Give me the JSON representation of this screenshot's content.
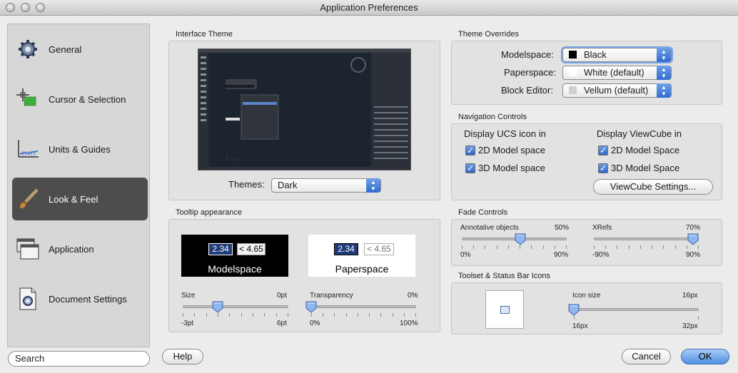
{
  "window": {
    "title": "Application Preferences"
  },
  "sidebar": {
    "items": [
      {
        "label": "General",
        "icon": "gear-icon"
      },
      {
        "label": "Cursor & Selection",
        "icon": "crosshair-icon"
      },
      {
        "label": "Units & Guides",
        "icon": "ruler-icon"
      },
      {
        "label": "Look & Feel",
        "icon": "brush-icon",
        "active": true
      },
      {
        "label": "Application",
        "icon": "windows-icon"
      },
      {
        "label": "Document Settings",
        "icon": "document-icon"
      }
    ],
    "search_value": "Search"
  },
  "interface_theme": {
    "title": "Interface Theme",
    "themes_label": "Themes:",
    "themes_value": "Dark"
  },
  "tooltip": {
    "title": "Tooltip appearance",
    "model_value1": "2.34",
    "model_value2": "< 4.65",
    "model_label": "Modelspace",
    "paper_value1": "2.34",
    "paper_value2": "< 4.65",
    "paper_label": "Paperspace",
    "size": {
      "label": "Size",
      "current": "0pt",
      "min": "-3pt",
      "max": "6pt",
      "value_fraction": 0.33
    },
    "transparency": {
      "label": "Transparency",
      "current": "0%",
      "min": "0%",
      "max": "100%",
      "value_fraction": 0.0
    }
  },
  "theme_overrides": {
    "title": "Theme Overrides",
    "rows": [
      {
        "label": "Modelspace:",
        "value": "Black",
        "swatch": "#000000"
      },
      {
        "label": "Paperspace:",
        "value": "White (default)",
        "swatch": "#ffffff"
      },
      {
        "label": "Block Editor:",
        "value": "Vellum (default)",
        "swatch": "#d8d8d8"
      }
    ]
  },
  "navigation": {
    "title": "Navigation Controls",
    "ucs_heading": "Display UCS icon in",
    "ucs_2d": "2D Model space",
    "ucs_3d": "3D Model space",
    "vc_heading": "Display ViewCube in",
    "vc_2d": "2D Model Space",
    "vc_3d": "3D Model Space",
    "settings_button": "ViewCube Settings..."
  },
  "fade": {
    "title": "Fade Controls",
    "annotative": {
      "label": "Annotative objects",
      "current": "50%",
      "min": "0%",
      "max": "90%",
      "value_fraction": 0.556
    },
    "xrefs": {
      "label": "XRefs",
      "current": "70%",
      "min": "-90%",
      "max": "90%",
      "value_fraction": 0.944
    }
  },
  "toolset": {
    "title": "Toolset & Status Bar Icons",
    "icon_size_label": "Icon size",
    "current": "16px",
    "min": "16px",
    "max": "32px",
    "value_fraction": 0.0
  },
  "footer": {
    "help": "Help",
    "cancel": "Cancel",
    "ok": "OK"
  },
  "colors": {
    "accent": "#3f7fde",
    "active_sidebar": "#4d4d4d",
    "preview_bg": "#1c2430"
  }
}
